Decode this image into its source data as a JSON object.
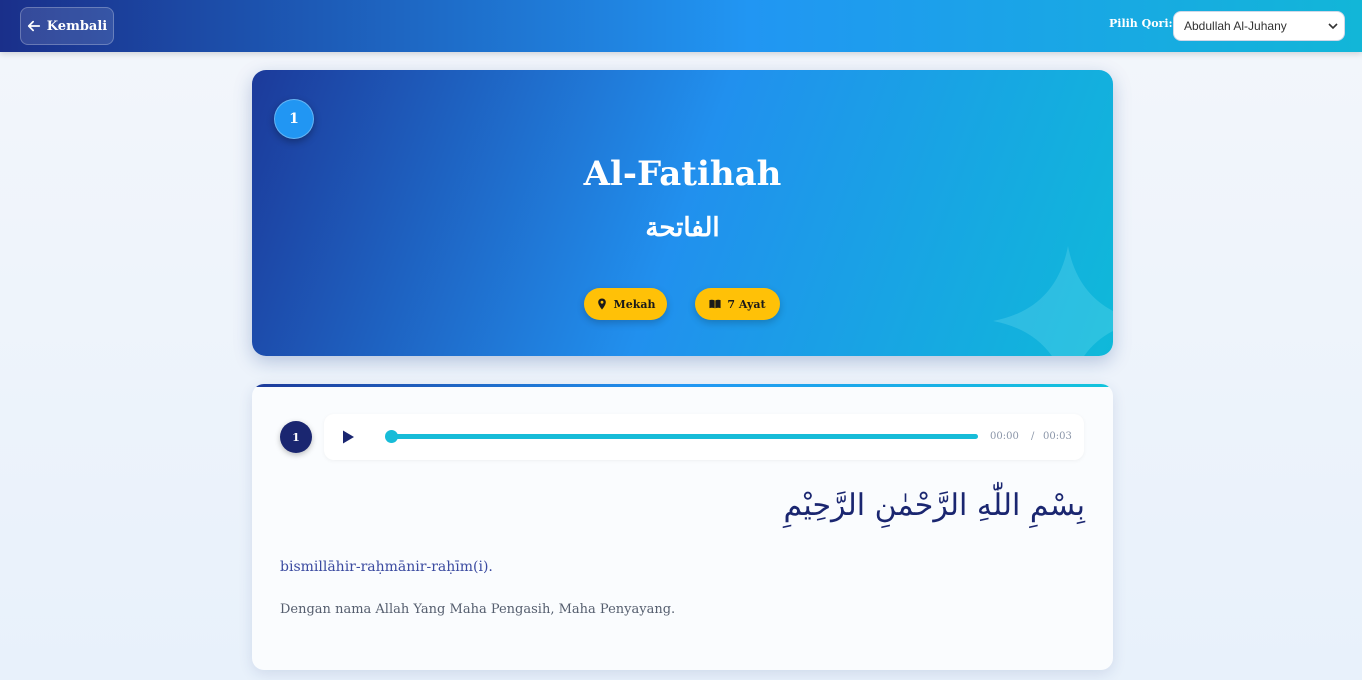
{
  "topbar": {
    "back_label": "Kembali",
    "qori_label": "Pilih Qori:",
    "qori_selected": "Abdullah Al-Juhany"
  },
  "surah": {
    "number": "1",
    "name": "Al-Fatihah",
    "arabic": "الفاتحة",
    "place": "Mekah",
    "ayat_count": "7 Ayat"
  },
  "ayat": {
    "number": "1",
    "audio": {
      "current_time": "00:00",
      "separator": "/",
      "duration": "00:03",
      "progress": 0
    },
    "arabic": "بِسْمِ اللّٰهِ الرَّحْمٰنِ الرَّحِيْمِ",
    "latin": "bismillāhir-raḥmānir-raḥīm(i).",
    "translation": "Dengan nama Allah Yang Maha Pengasih, Maha Penyayang."
  },
  "colors": {
    "accent": "#2196f3",
    "badge_yellow": "#ffc107",
    "dark_navy": "#1a2670",
    "audio_cyan": "#17bcd8"
  },
  "icons": {
    "back": "arrow-left-icon",
    "select": "chevron-down-icon",
    "place": "map-marker-icon",
    "ayat": "book-open-icon",
    "play": "play-icon"
  }
}
